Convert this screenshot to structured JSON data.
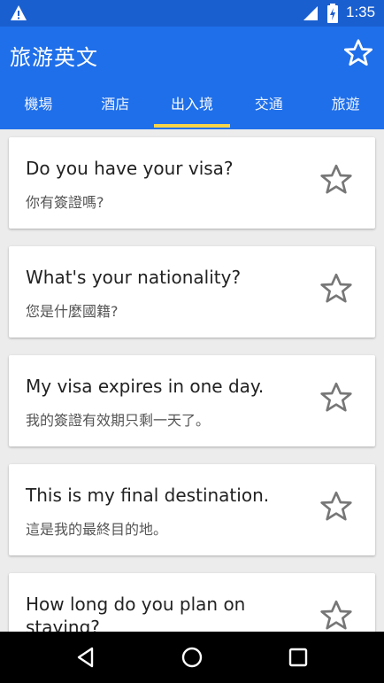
{
  "status_bar": {
    "time": "1:35",
    "icons": [
      "warning-icon",
      "signal-icon",
      "battery-icon"
    ]
  },
  "app_bar": {
    "title": "旅游英文",
    "favorites_icon": "star-outline-icon"
  },
  "tabs": [
    {
      "label": "機場",
      "active": false
    },
    {
      "label": "酒店",
      "active": false
    },
    {
      "label": "出入境",
      "active": true
    },
    {
      "label": "交通",
      "active": false
    },
    {
      "label": "旅遊",
      "active": false
    }
  ],
  "phrases": [
    {
      "en": "Do you have your visa?",
      "zh": "你有簽證嗎?"
    },
    {
      "en": "What's your nationality?",
      "zh": "您是什麼國籍?"
    },
    {
      "en": "My visa expires in one day.",
      "zh": "我的簽證有效期只剩一天了。"
    },
    {
      "en": "This is my final destination.",
      "zh": "這是我的最終目的地。"
    },
    {
      "en": "How long do you plan on staying?",
      "zh": ""
    }
  ],
  "nav_bar": {
    "icons": [
      "back-icon",
      "home-icon",
      "recents-icon"
    ]
  },
  "colors": {
    "status_bar": "#1a5fd0",
    "app_bar": "#1f6fea",
    "tab_indicator": "#f5d44a",
    "background": "#ececec"
  }
}
